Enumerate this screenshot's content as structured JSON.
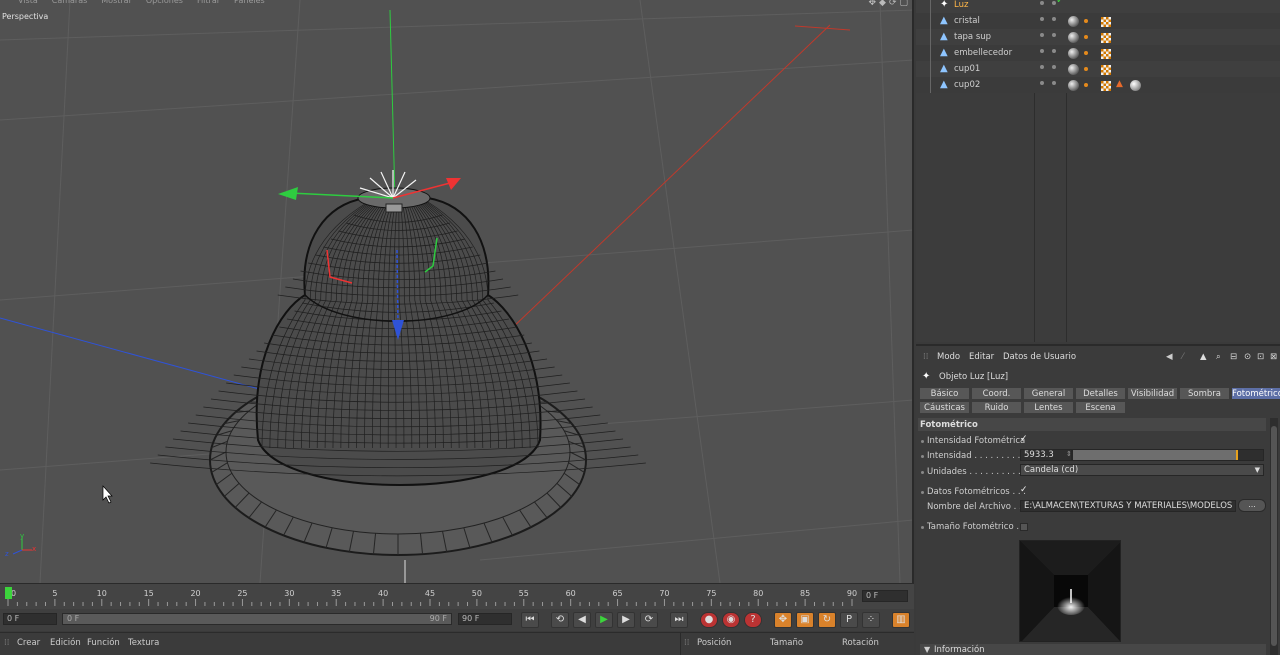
{
  "viewport": {
    "menu": [
      "Vista",
      "Cámaras",
      "Mostrar",
      "Opciones",
      "Filtrar",
      "Paneles"
    ],
    "label": "Perspectiva"
  },
  "timeline": {
    "ticks": [
      "0",
      "5",
      "10",
      "15",
      "20",
      "25",
      "30",
      "35",
      "40",
      "45",
      "50",
      "55",
      "60",
      "65",
      "70",
      "75",
      "80",
      "85",
      "90"
    ],
    "current_frame": "0 F",
    "start_frame": "0 F",
    "range_start": "0 F",
    "range_end": "90 F",
    "end_frame": "90 F"
  },
  "bottom": {
    "menu": [
      "Crear",
      "Edición",
      "Función",
      "Textura"
    ],
    "coords": [
      "Posición",
      "Tamaño",
      "Rotación"
    ]
  },
  "objects": [
    {
      "name": "Luz",
      "icon": "light-icon",
      "active": true
    },
    {
      "name": "cristal",
      "icon": "object-icon"
    },
    {
      "name": "tapa sup",
      "icon": "object-icon"
    },
    {
      "name": "embellecedor",
      "icon": "object-icon"
    },
    {
      "name": "cup01",
      "icon": "object-icon"
    },
    {
      "name": "cup02",
      "icon": "object-icon"
    }
  ],
  "attributes": {
    "menu": [
      "Modo",
      "Editar",
      "Datos de Usuario"
    ],
    "object_title": "Objeto Luz  [Luz]",
    "tabs_row1": [
      "Básico",
      "Coord.",
      "General",
      "Detalles",
      "Visibilidad",
      "Sombra",
      "Fotométrico"
    ],
    "tabs_row2": [
      "Cáusticas",
      "Ruido",
      "Lentes",
      "Escena"
    ],
    "active_tab": "Fotométrico",
    "section_title": "Fotométrico",
    "props": {
      "intensidad_fotometrica_label": "Intensidad Fotométrica",
      "intensidad_label": "Intensidad . . . . . . . . . .",
      "intensidad_value": "5933.3",
      "unidades_label": "Unidades . . . . . . . . . . .",
      "unidades_value": "Candela (cd)",
      "datos_label": "Datos Fotométricos . . .",
      "nombre_label": "Nombre del Archivo . . .",
      "nombre_value": "E:\\ALMACEN\\TEXTURAS Y MATERIALES\\MODELOS CIN",
      "nombre_button": "...",
      "tamano_label": "Tamaño Fotométrico . ."
    },
    "intensity_fraction": 0.86,
    "info_label": "Información"
  },
  "colors": {
    "axis_x": "#c0392b",
    "axis_y": "#2ecc40",
    "axis_z": "#2f53d8",
    "active_tab": "#5d6fa6",
    "active_object": "#ffb648"
  }
}
